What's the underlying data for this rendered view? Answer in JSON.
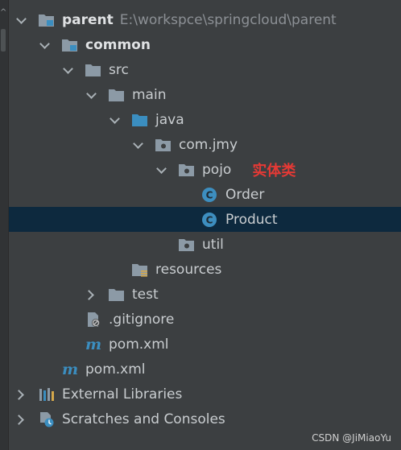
{
  "tree": {
    "root": {
      "label": "parent",
      "path": "E:\\workspce\\springcloud\\parent"
    },
    "module": {
      "label": "common"
    },
    "src": "src",
    "main": "main",
    "java": "java",
    "package": "com.jmy",
    "pojo": "pojo",
    "annotation": "实体类",
    "classes": [
      "Order",
      "Product"
    ],
    "util": "util",
    "resources": "resources",
    "test": "test",
    "gitignore": ".gitignore",
    "pom_module": "pom.xml",
    "pom_root": "pom.xml",
    "external": "External Libraries",
    "scratches": "Scratches and Consoles"
  },
  "selected": "Product",
  "colors": {
    "selection": "#0d293e",
    "annotation": "#e53935",
    "class_icon": "#3d8ebf",
    "folder": "#8c9aa6",
    "source_folder": "#3b8ec0"
  },
  "watermark": "CSDN @JiMiaoYu"
}
